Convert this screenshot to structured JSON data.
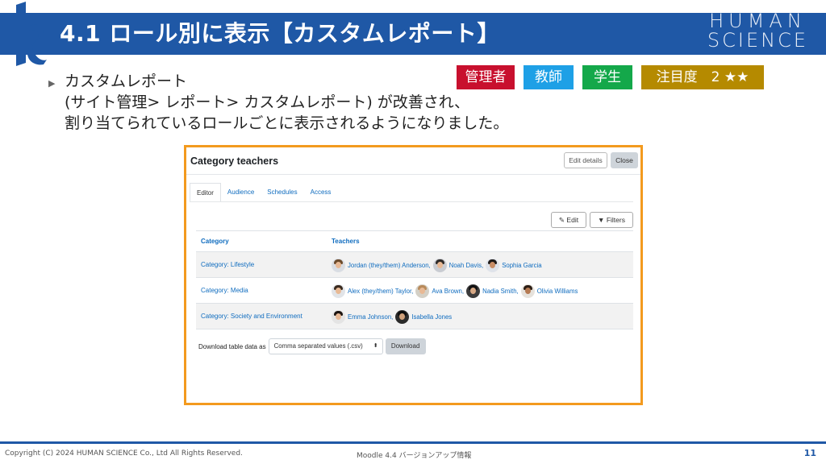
{
  "slide": {
    "title": "4.1 ロール別に表示【カスタムレポート】",
    "brand_line1": "HUMAN",
    "brand_line2": "SCIENCE",
    "badges": {
      "admin": "管理者",
      "teacher": "教師",
      "student": "学生",
      "attention": "注目度　2 ★★"
    },
    "body_lines": [
      "カスタムレポート",
      "(サイト管理> レポート> カスタムレポート) が改善され、",
      "割り当てられているロールごとに表示されるようになりました。"
    ],
    "footer": {
      "copyright": "Copyright (C) 2024 HUMAN SCIENCE Co., Ltd All Rights Reserved.",
      "center": "Moodle 4.4 バージョンアップ情報",
      "page": "11"
    }
  },
  "report": {
    "title": "Category teachers",
    "edit_details_label": "Edit details",
    "close_label": "Close",
    "tabs": [
      "Editor",
      "Audience",
      "Schedules",
      "Access"
    ],
    "edit_label": "Edit",
    "filters_label": "Filters",
    "columns": [
      "Category",
      "Teachers"
    ],
    "rows": [
      {
        "category": "Category: Lifestyle",
        "teachers": [
          "Jordan (they/them) Anderson,",
          "Noah Davis,",
          "Sophia Garcia"
        ]
      },
      {
        "category": "Category: Media",
        "teachers": [
          "Alex (they/them) Taylor,",
          "Ava Brown,",
          "Nadia Smith,",
          "Olivia Williams"
        ]
      },
      {
        "category": "Category: Society and Environment",
        "teachers": [
          "Emma Johnson,",
          "Isabella Jones"
        ]
      }
    ],
    "download_label": "Download table data as",
    "download_format": "Comma separated values (.csv)",
    "download_button": "Download"
  },
  "colors": {
    "header_blue": "#1f58a6",
    "frame_orange": "#f39a1e",
    "link_blue": "#0f6cbf"
  }
}
